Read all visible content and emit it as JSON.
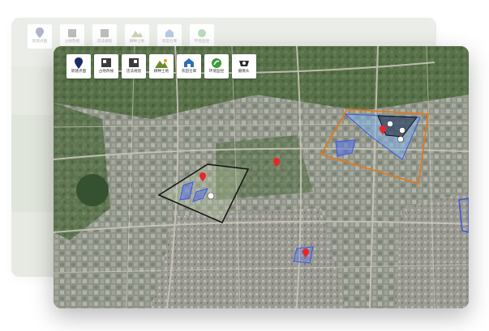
{
  "toolbar": {
    "items": [
      {
        "label": "新建点图",
        "icon": "map-pin-icon"
      },
      {
        "label": "占地改规",
        "icon": "land-use-icon"
      },
      {
        "label": "违法规划",
        "icon": "violation-icon"
      },
      {
        "label": "耕种土地",
        "icon": "farmland-icon"
      },
      {
        "label": "农田仓库",
        "icon": "warehouse-icon"
      },
      {
        "label": "环境监控",
        "icon": "environment-icon"
      },
      {
        "label": "摄像头",
        "icon": "camera-icon"
      }
    ]
  },
  "ghost_toolbar": {
    "items": [
      {
        "label": "新建点图"
      },
      {
        "label": "占地改规"
      },
      {
        "label": "违法规划"
      },
      {
        "label": "耕种土地"
      },
      {
        "label": "农田仓库"
      },
      {
        "label": "环境监控"
      }
    ]
  },
  "colors": {
    "pin": "#e8262a",
    "polygon_black": "#111111",
    "polygon_orange": "#e07a1f",
    "polygon_blue": "#3a57e8",
    "polygon_blue_fill": "#4d6cf0",
    "region_light_blue": "#7fb2e8"
  }
}
